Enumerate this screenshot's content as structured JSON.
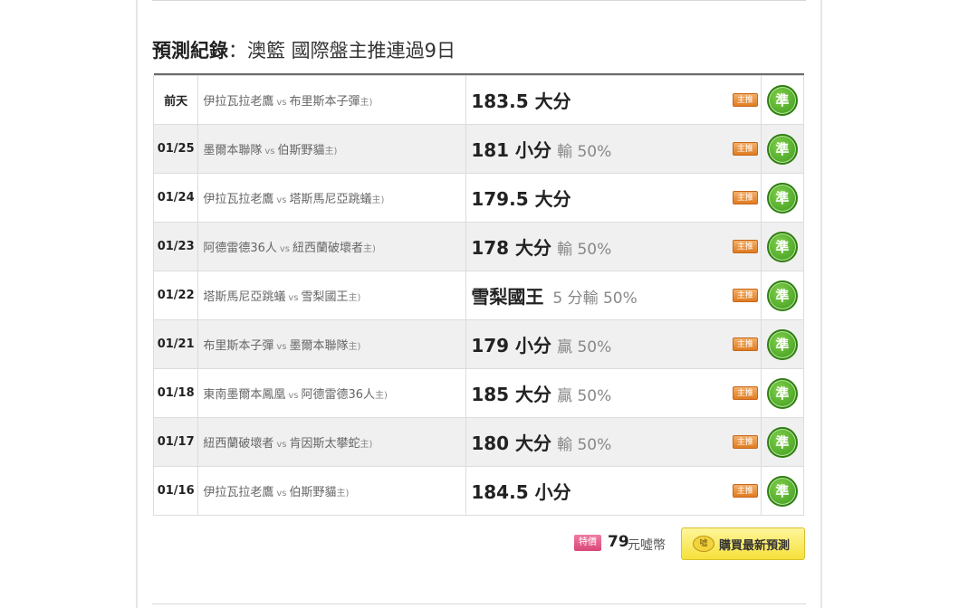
{
  "section": {
    "title_bold": "預測紀錄",
    "title_rest": "：澳籃 國際盤主推連過9日"
  },
  "records": [
    {
      "date": "前天",
      "home": "伊拉瓦拉老鷹",
      "vs": "vs",
      "away": "布里斯本子彈",
      "zhu": "主)",
      "pick": "183.5 大分",
      "sub": "",
      "tag": "主推",
      "result": "準"
    },
    {
      "date": "01/25",
      "home": "墨爾本聯隊",
      "vs": "vs",
      "away": "伯斯野貓",
      "zhu": "主)",
      "pick": "181 小分",
      "sub": "輸 50%",
      "tag": "主推",
      "result": "準"
    },
    {
      "date": "01/24",
      "home": "伊拉瓦拉老鷹",
      "vs": "vs",
      "away": "塔斯馬尼亞跳蟻",
      "zhu": "主)",
      "pick": "179.5 大分",
      "sub": "",
      "tag": "主推",
      "result": "準"
    },
    {
      "date": "01/23",
      "home": "阿德雷德36人",
      "vs": "vs",
      "away": "紐西蘭破壞者",
      "zhu": "主)",
      "pick": "178 大分",
      "sub": "輸 50%",
      "tag": "主推",
      "result": "準"
    },
    {
      "date": "01/22",
      "home": "塔斯馬尼亞跳蟻",
      "vs": "vs",
      "away": "雪梨國王",
      "zhu": "主)",
      "pick": "雪梨國王",
      "sub": "5 分輸 50%",
      "tag": "主推",
      "result": "準"
    },
    {
      "date": "01/21",
      "home": "布里斯本子彈",
      "vs": "vs",
      "away": "墨爾本聯隊",
      "zhu": "主)",
      "pick": "179 小分",
      "sub": "贏 50%",
      "tag": "主推",
      "result": "準"
    },
    {
      "date": "01/18",
      "home": "東南墨爾本鳳凰",
      "vs": "vs",
      "away": "阿德雷德36人",
      "zhu": "主)",
      "pick": "185 大分",
      "sub": "贏 50%",
      "tag": "主推",
      "result": "準"
    },
    {
      "date": "01/17",
      "home": "紐西蘭破壞者",
      "vs": "vs",
      "away": "肯因斯太攀蛇",
      "zhu": "主)",
      "pick": "180 大分",
      "sub": "輸 50%",
      "tag": "主推",
      "result": "準"
    },
    {
      "date": "01/16",
      "home": "伊拉瓦拉老鷹",
      "vs": "vs",
      "away": "伯斯野貓",
      "zhu": "主)",
      "pick": "184.5 小分",
      "sub": "",
      "tag": "主推",
      "result": "準"
    }
  ],
  "footer": {
    "special_label": "特價",
    "price": "79",
    "price_unit": "元噓幣",
    "buy_icon": "噓",
    "buy_label": "購買最新預測"
  }
}
